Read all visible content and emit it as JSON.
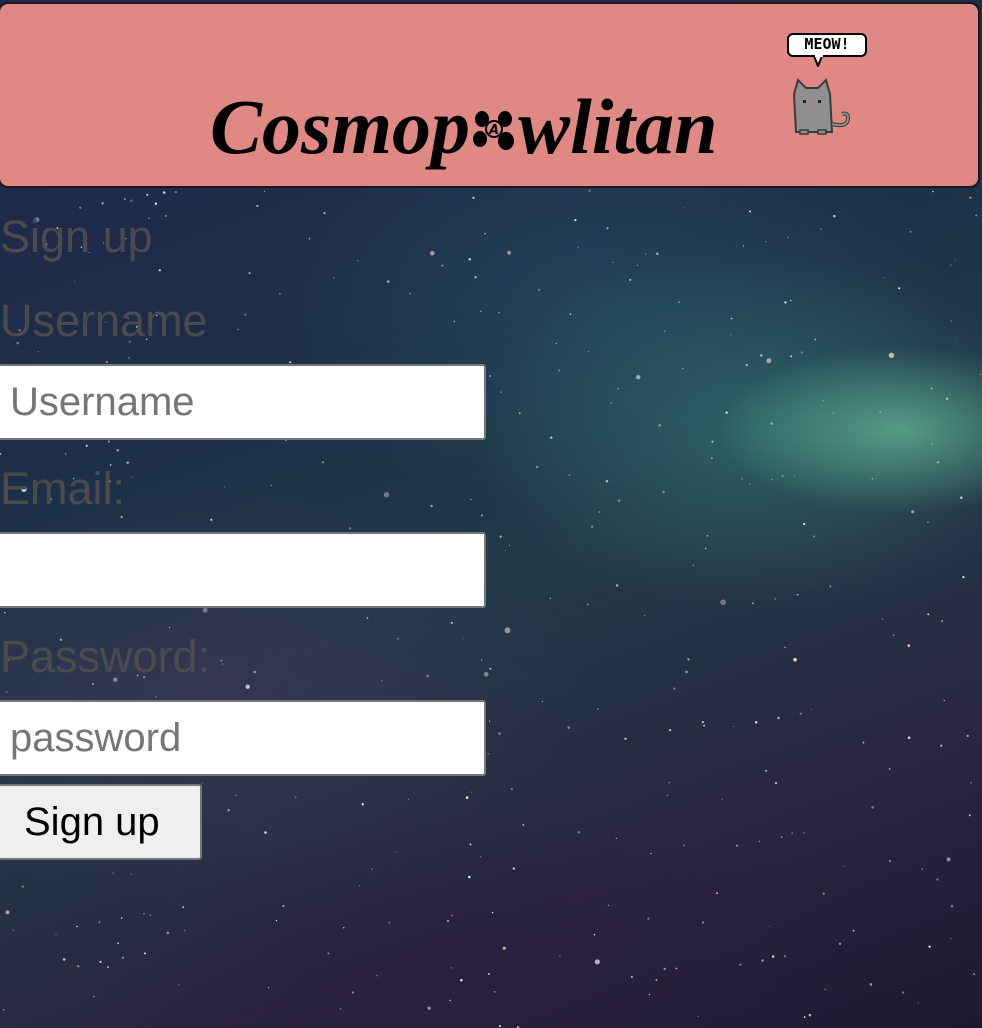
{
  "header": {
    "logo_before": "Cosmop",
    "logo_after": "wlitan",
    "speech_bubble": "MEOW!",
    "paw_icon": "paw-icon",
    "cat_icon": "cat-icon",
    "background_color": "#e08884"
  },
  "form": {
    "title": "Sign up",
    "username_label": "Username",
    "username_placeholder": "Username",
    "username_value": "",
    "email_label": "Email:",
    "email_placeholder": "",
    "email_value": "",
    "password_label": "Password:",
    "password_placeholder": "password",
    "password_value": "",
    "submit_label": "Sign up"
  },
  "colors": {
    "label_text": "#4b4b4b",
    "input_border": "#767676",
    "button_bg": "#efefef"
  }
}
